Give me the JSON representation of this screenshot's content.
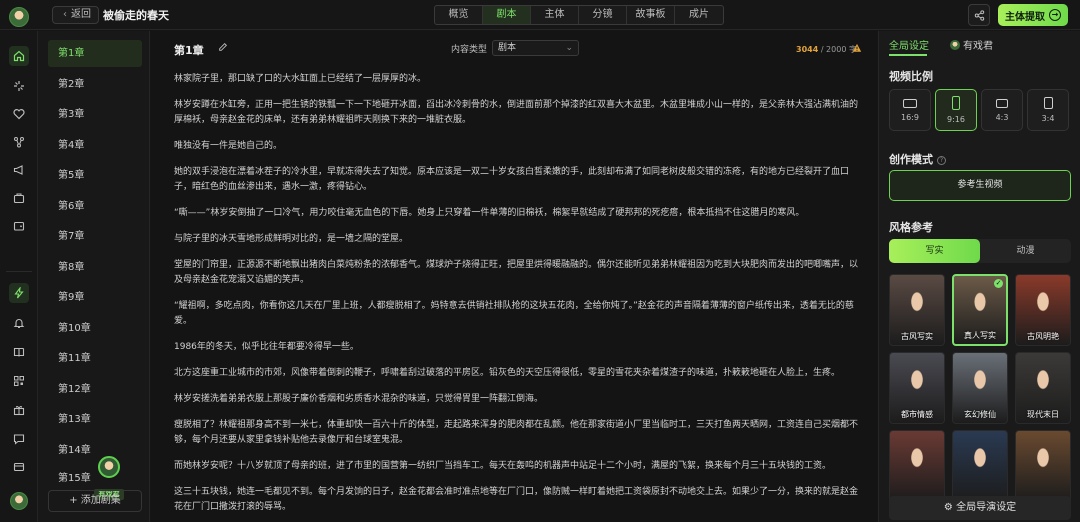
{
  "header": {
    "back_label": "返回",
    "project_title": "被偷走的春天",
    "tabs": [
      "概览",
      "剧本",
      "主体",
      "分镜",
      "故事板",
      "成片"
    ],
    "active_tab": "剧本",
    "extract_label": "主体提取"
  },
  "rail": {
    "icons": [
      "home-icon",
      "sparkle-icon",
      "heart-icon",
      "share-nodes-icon",
      "megaphone-icon",
      "briefcase-icon",
      "wallet-icon",
      "lightning-icon",
      "bell-icon",
      "book-icon",
      "qr-code-icon",
      "gift-icon",
      "chat-icon",
      "card-icon"
    ]
  },
  "chapters": {
    "items": [
      "第1章",
      "第2章",
      "第3章",
      "第4章",
      "第5章",
      "第6章",
      "第7章",
      "第8章",
      "第9章",
      "第10章",
      "第11章",
      "第12章",
      "第13章",
      "第14章",
      "第15章"
    ],
    "active_index": 0,
    "add_label": "+ 添加剧集",
    "floating_badge": "有戏君"
  },
  "editor": {
    "chapter_title": "第1章",
    "type_label": "内容类型",
    "type_value": "剧本",
    "word_count_current": "3044",
    "word_count_limit": "/ 2000 字",
    "paragraphs": [
      "林家院子里，那口缺了口的大水缸面上已经结了一层厚厚的冰。",
      "林岁安蹲在水缸旁，正用一把生锈的铁瓢一下一下地砸开冰面，舀出冰冷刺骨的水，倒进面前那个掉漆的红双喜大木盆里。木盆里堆成小山一样的，是父亲林大强沾满机油的厚棉袄，母亲赵金花的床单，还有弟弟林耀祖昨天刚换下来的一堆脏衣服。",
      "唯独没有一件是她自己的。",
      "她的双手浸泡在漂着冰茬子的冷水里，早就冻得失去了知觉。原本应该是一双二十岁女孩白皙柔嫩的手，此刻却布满了如同老树皮般交错的冻疮，有的地方已经裂开了血口子，暗红色的血丝渗出来，遇水一激，疼得钻心。",
      "“嘶——”林岁安倒抽了一口冷气，用力咬住毫无血色的下唇。她身上只穿着一件单薄的旧棉袄，棉絮早就结成了硬邦邦的死疙瘩，根本抵挡不住这腊月的寒风。",
      "与院子里的冰天雪地形成鲜明对比的，是一墙之隔的堂屋。",
      "堂屋的门帘里，正源源不断地飘出猪肉白菜炖粉条的浓郁香气。煤球炉子烧得正旺，把屋里烘得暖融融的。偶尔还能听见弟弟林耀祖因为吃到大块肥肉而发出的吧唧嘴声，以及母亲赵金花宠溺又谄媚的笑声。",
      "“耀祖啊，多吃点肉，你看你这几天在厂里上班，人都瘦脱相了。妈特意去供销社排队抢的这块五花肉，全给你炖了。”赵金花的声音隔着薄薄的窗户纸传出来，透着无比的慈爱。",
      "1986年的冬天，似乎比往年都要冷得早一些。",
      "北方这座重工业城市的市郊，风像带着倒刺的鞭子，呼啸着刮过破落的平房区。铅灰色的天空压得很低，零星的雪花夹杂着煤渣子的味道，扑簌簌地砸在人脸上，生疼。",
      "林岁安搓洗着弟弟衣服上那股子廉价香烟和劣质香水混杂的味道，只觉得胃里一阵翻江倒海。",
      "瘦脱相了？林耀祖那身高不到一米七，体重却快一百六十斤的体型，走起路来浑身的肥肉都在乱颤。他在那家街道小厂里当临时工，三天打鱼两天晒网，工资连自己买烟都不够，每个月还要从家里拿钱补贴他去录像厅和台球室鬼混。",
      "而她林岁安呢？十八岁就顶了母亲的班，进了市里的国营第一纺织厂当挡车工。每天在轰鸣的机器声中站足十二个小时，满屋的飞絮，换来每个月三十五块钱的工资。",
      "这三十五块钱，她连一毛都见不到。每个月发饷的日子，赵金花都会准时准点地等在厂门口，像防贼一样盯着她把工资袋原封不动地交上去。如果少了一分，换来的就是赵金花在厂门口撒泼打滚的辱骂。"
    ]
  },
  "right_panel": {
    "tabs": [
      "全局设定",
      "有戏君"
    ],
    "active_tab": "全局设定",
    "ratio_title": "视频比例",
    "ratios": [
      "16:9",
      "9:16",
      "4:3",
      "3:4"
    ],
    "active_ratio": "9:16",
    "mode_title": "创作模式",
    "mode_button": "参考生视频",
    "style_title": "风格参考",
    "style_tabs": [
      "写实",
      "动漫"
    ],
    "active_style_tab": "写实",
    "styles": [
      {
        "label": "古风写实",
        "color": "#5a4a44"
      },
      {
        "label": "真人写实",
        "color": "#6b5a48"
      },
      {
        "label": "古风明艳",
        "color": "#8a3a2a"
      },
      {
        "label": "都市情感",
        "color": "#4a4a52"
      },
      {
        "label": "玄幻修仙",
        "color": "#6a7078"
      },
      {
        "label": "现代末日",
        "color": "#3c3a38"
      },
      {
        "label": "",
        "color": "#6a3a34"
      },
      {
        "label": "",
        "color": "#2a3a52"
      },
      {
        "label": "",
        "color": "#6a4a30"
      }
    ],
    "selected_style": "真人写实",
    "director_button": "全局导演设定"
  },
  "colors": {
    "accent": "#7de06a",
    "background": "#151515",
    "warning": "#e3a33a"
  }
}
